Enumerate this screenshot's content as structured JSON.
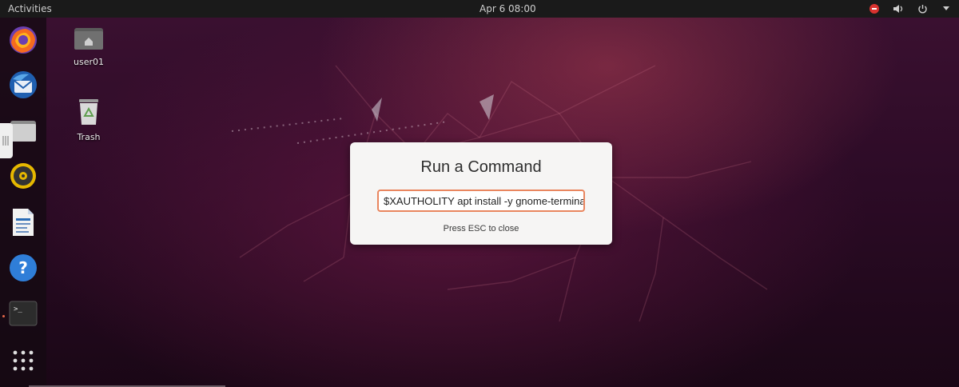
{
  "topbar": {
    "activities": "Activities",
    "clock": "Apr 6  08:00",
    "icons": [
      "stop-icon",
      "volume-icon",
      "power-icon"
    ]
  },
  "dock": {
    "items": [
      {
        "name": "firefox",
        "icon": "firefox-icon"
      },
      {
        "name": "thunderbird",
        "icon": "thunderbird-icon"
      },
      {
        "name": "files",
        "icon": "files-icon"
      },
      {
        "name": "rhythmbox",
        "icon": "rhythmbox-icon"
      },
      {
        "name": "writer",
        "icon": "writer-icon"
      },
      {
        "name": "help",
        "icon": "help-icon"
      },
      {
        "name": "terminal",
        "icon": "terminal-icon"
      },
      {
        "name": "show-applications",
        "icon": "app-grid-icon"
      }
    ]
  },
  "desktop": {
    "home_label": "user01",
    "trash_label": "Trash"
  },
  "dialog": {
    "title": "Run a Command",
    "command_value": "$XAUTHOLITY apt install -y gnome-terminal",
    "hint": "Press ESC to close"
  },
  "colors": {
    "accent": "#e9865f",
    "wallpaper": "#2c0b26",
    "topbar": "#1a1a1a"
  }
}
